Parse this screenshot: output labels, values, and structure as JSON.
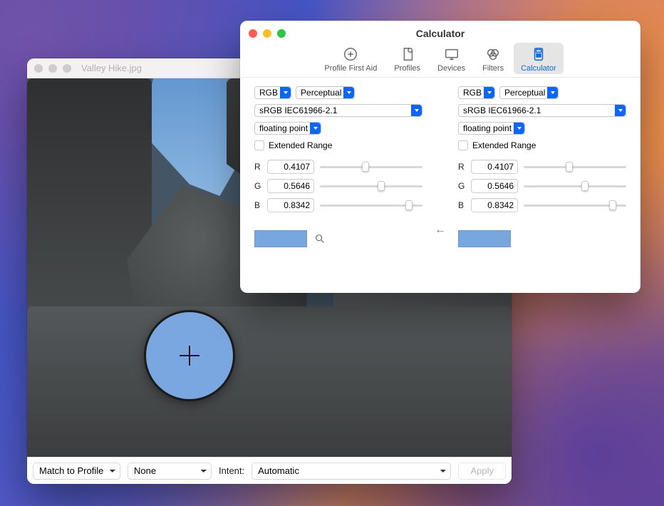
{
  "viewer": {
    "title": "Valley Hike.jpg",
    "footer": {
      "mode": "Match to Profile",
      "profile": "None",
      "intent_label": "Intent:",
      "intent": "Automatic",
      "apply": "Apply"
    }
  },
  "calc": {
    "title": "Calculator",
    "toolbar": {
      "firstaid": "Profile First Aid",
      "profiles": "Profiles",
      "devices": "Devices",
      "filters": "Filters",
      "calculator": "Calculator"
    },
    "arrow": "←",
    "left": {
      "model": "RGB",
      "intent": "Perceptual",
      "profile": "sRGB IEC61966-2.1",
      "format": "floating point",
      "extended_label": "Extended Range",
      "channels": {
        "r_label": "R",
        "g_label": "G",
        "b_label": "B",
        "r": "0.4107",
        "g": "0.5646",
        "b": "0.8342"
      }
    },
    "right": {
      "model": "RGB",
      "intent": "Perceptual",
      "profile": "sRGB IEC61966-2.1",
      "format": "floating point",
      "extended_label": "Extended Range",
      "channels": {
        "r_label": "R",
        "g_label": "G",
        "b_label": "B",
        "r": "0.4107",
        "g": "0.5646",
        "b": "0.8342"
      }
    },
    "swatch_color": "#78a6df"
  }
}
